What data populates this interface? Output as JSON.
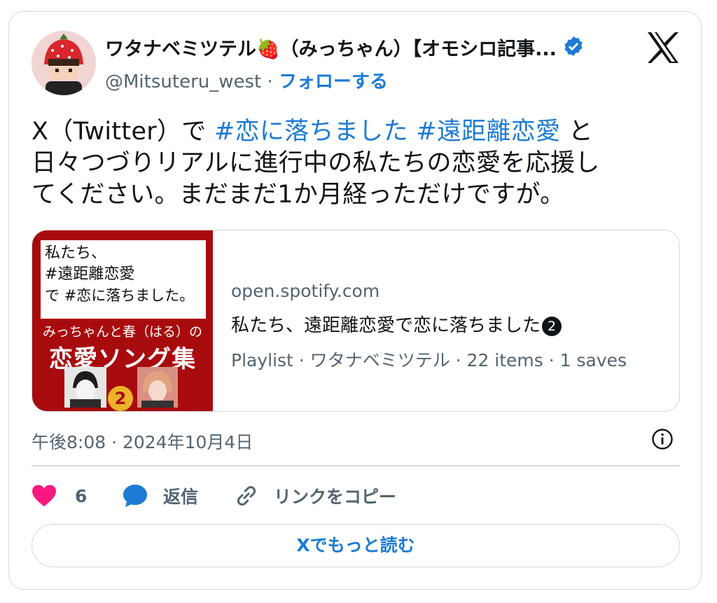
{
  "author": {
    "display_name": "ワタナベミツテル🍓（みっちゃん）【オモシロ記事...",
    "handle": "@Mitsuteru_west",
    "separator": " · ",
    "follow_label": "フォローする"
  },
  "tweet": {
    "line1_pre": "X（Twitter）で ",
    "hashtag1": "#恋に落ちました",
    "hashtag2": "#遠距離恋愛",
    "line1_post": " と",
    "line2": "日々つづりリアルに進行中の私たちの恋愛を応援し",
    "line3": "てください。まだまだ1か月経っただけですが。"
  },
  "link_card": {
    "thumbnail": {
      "box_line1": "私たち、",
      "box_line2": "#遠距離恋愛",
      "box_line3": "で #恋に落ちました。",
      "subtitle": "みっちゃんと春（はる）の",
      "title": "恋愛ソング集",
      "number": "2"
    },
    "domain": "open.spotify.com",
    "title": "私たち、遠距離恋愛で恋に落ちました",
    "title_badge": "2",
    "description": "Playlist · ワタナベミツテル · 22 items · 1 saves"
  },
  "timestamp": "午後8:08 · 2024年10月4日",
  "actions": {
    "like_count": "6",
    "reply_label": "返信",
    "copy_link_label": "リンクをコピー"
  },
  "read_more_label": "Xでもっと読む",
  "colors": {
    "accent": "#1d7bd3",
    "like": "#f91880",
    "border": "#cfd9de",
    "muted": "#536471",
    "thumb_bg": "#a80b0e"
  },
  "icons": [
    "avatar",
    "verified-badge-icon",
    "x-logo-icon",
    "info-icon",
    "heart-icon",
    "reply-bubble-icon",
    "link-icon"
  ]
}
